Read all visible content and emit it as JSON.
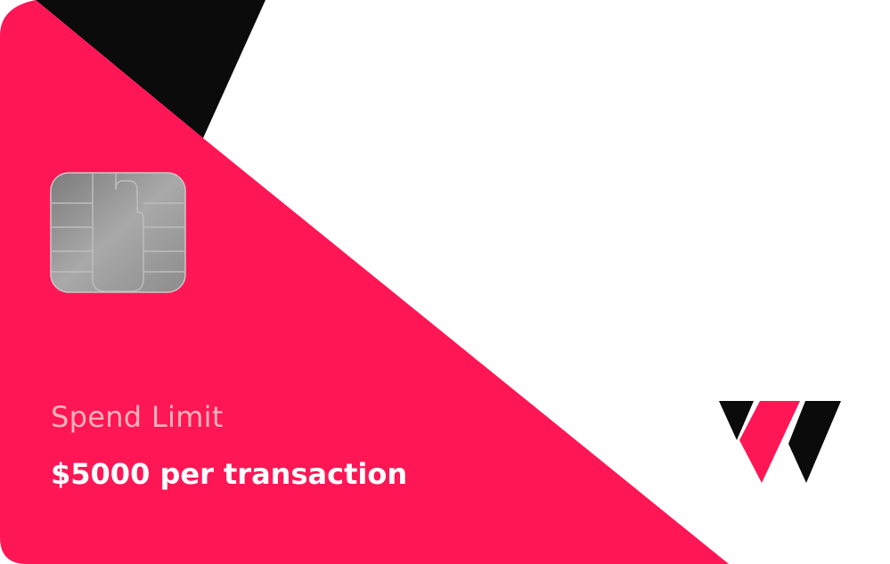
{
  "card": {
    "spend_limit_label": "Spend Limit",
    "spend_limit_value": "$5000 per transaction",
    "brand_logo": "w-logo-icon",
    "chip_icon": "emv-chip-icon"
  },
  "colors": {
    "primary": "#ff1655",
    "dark": "#0b0b0b",
    "label": "#ffb3b8",
    "value": "#ffffff",
    "background": "#ffffff"
  }
}
